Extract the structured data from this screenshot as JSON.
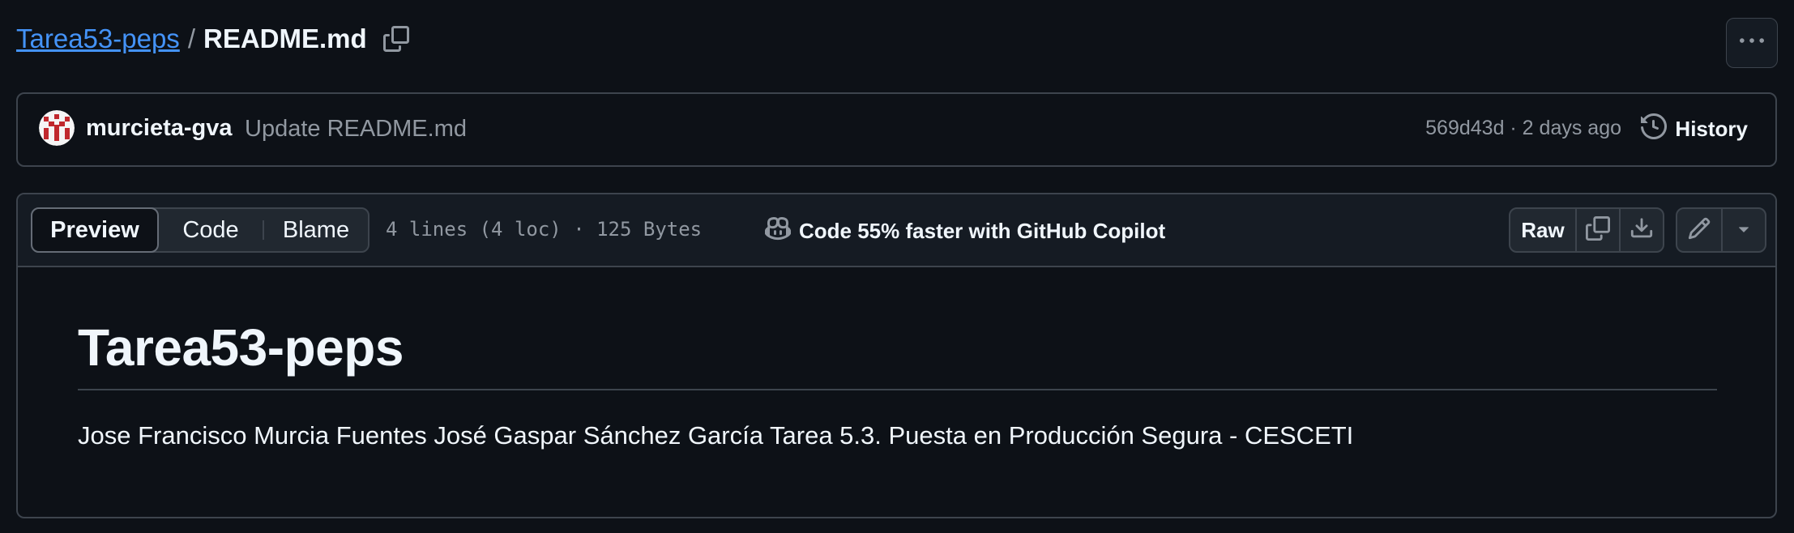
{
  "breadcrumb": {
    "repo": "Tarea53-peps",
    "separator": "/",
    "file": "README.md"
  },
  "commit": {
    "author": "murcieta-gva",
    "message": "Update README.md",
    "meta": "569d43d · 2 days ago",
    "history_label": "History"
  },
  "file_header": {
    "tabs": [
      {
        "label": "Preview",
        "selected": true
      },
      {
        "label": "Code",
        "selected": false
      },
      {
        "label": "Blame",
        "selected": false
      }
    ],
    "info": "4 lines (4 loc) · 125 Bytes",
    "copilot_label": "Code 55% faster with GitHub Copilot",
    "raw_label": "Raw",
    "icons": [
      "copy-icon",
      "download-icon",
      "pencil-icon",
      "triangle-down-icon"
    ]
  },
  "readme": {
    "title": "Tarea53-peps",
    "body": "Jose Francisco Murcia Fuentes José Gaspar Sánchez García Tarea 5.3. Puesta en Producción Segura - CESCETI"
  },
  "colors": {
    "background": "#0d1117",
    "link": "#4493f8",
    "border": "#3d444d",
    "muted": "#9198a1"
  }
}
